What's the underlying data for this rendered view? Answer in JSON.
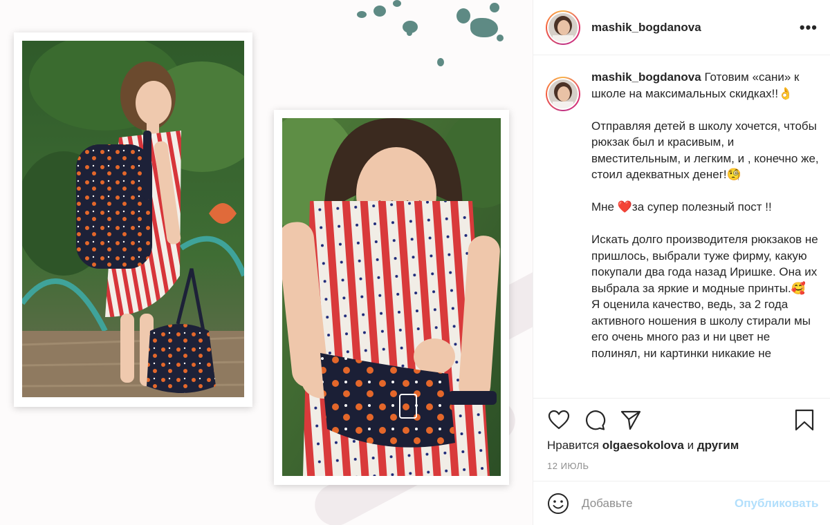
{
  "post": {
    "author": "mashik_bogdanova",
    "more_label": "•••",
    "caption_text": "Готовим «сани» к школе на максимальных скидках!!👌\n\nОтправляя детей в школу хочется, чтобы рюкзак был и красивым, и вместительным, и легким, и , конечно же, стоил адекватных денег!🧐\n\nМне ❤️за супер полезный пост !!\n\nИскать долго производителя рюкзаков не пришлось, выбрали туже фирму, какую покупали два года назад Иришке. Она их выбрала за яркие и модные принты.🥰\nЯ оценила качество, ведь, за 2 года активного ношения в школу стирали мы его очень много раз и ни цвет не полинял, ни картинки никакие не",
    "likes_prefix": "Нравится ",
    "likes_user": "olgaesokolova",
    "likes_middle": " и ",
    "likes_suffix": "другим",
    "date": "12 ИЮЛЬ"
  },
  "comment": {
    "placeholder": "Добавьте",
    "publish_label": "Опубликовать"
  },
  "icons": {
    "like": "heart-icon",
    "comment": "comment-icon",
    "share": "share-icon",
    "save": "bookmark-icon",
    "emoji": "emoji-icon"
  },
  "colors": {
    "text": "#262626",
    "muted": "#8e8e8e",
    "publish_disabled": "#b2dffc",
    "border": "#efefef",
    "splash": "#5e8a84"
  }
}
